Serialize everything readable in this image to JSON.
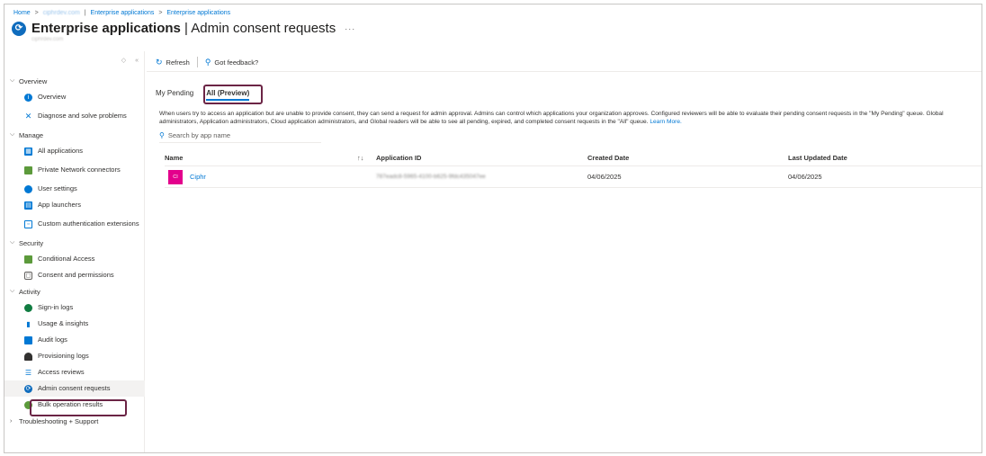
{
  "breadcrumb": {
    "home": "Home",
    "tenant": "ciphrdev.com",
    "ent_apps_1": "Enterprise applications",
    "ent_apps_2": "Enterprise applications"
  },
  "header": {
    "title_bold": "Enterprise applications",
    "title_rest": "Admin consent requests",
    "more": "···",
    "tenant_sub": "ciphrdev.com"
  },
  "sidebar": {
    "tools": [
      "◇",
      "«"
    ],
    "groups": {
      "overview": "Overview",
      "manage": "Manage",
      "security": "Security",
      "activity": "Activity",
      "troubleshooting": "Troubleshooting + Support"
    },
    "items": {
      "overview": "Overview",
      "diagnose": "Diagnose and solve problems",
      "all_apps": "All applications",
      "private_net": "Private Network connectors",
      "user_settings": "User settings",
      "app_launchers": "App launchers",
      "custom_auth": "Custom authentication extensions",
      "conditional_access": "Conditional Access",
      "consent": "Consent and permissions",
      "signin_logs": "Sign-in logs",
      "usage": "Usage & insights",
      "audit": "Audit logs",
      "provisioning": "Provisioning logs",
      "access_reviews": "Access reviews",
      "admin_consent": "Admin consent requests",
      "bulk": "Bulk operation results"
    }
  },
  "toolbar": {
    "refresh": "Refresh",
    "feedback": "Got feedback?"
  },
  "tabs": {
    "my_pending": "My Pending",
    "all": "All (Preview)"
  },
  "description": {
    "text": "When users try to access an application but are unable to provide consent, they can send a request for admin approval. Admins can control which applications your organization approves. Configured reviewers will be able to evaluate their pending consent requests in the \"My Pending\" queue. Global administrators, Application administrators, Cloud application administrators, and Global readers will be able to see all pending, expired, and completed consent requests in the \"All\" queue.",
    "learn_more": "Learn More."
  },
  "search": {
    "placeholder": "Search by app name"
  },
  "table": {
    "columns": {
      "name": "Name",
      "sort": "↑↓",
      "app_id": "Application ID",
      "created": "Created Date",
      "updated": "Last Updated Date"
    },
    "rows": [
      {
        "avatar": "CI",
        "name": "Ciphr",
        "app_id": "787eadc8-5965-4100-b625-9fdc435047ee",
        "created": "04/06/2025",
        "updated": "04/06/2025"
      }
    ]
  },
  "colors": {
    "accent": "#0078d4",
    "highlight_box": "#6b2445",
    "avatar": "#e3008c"
  }
}
